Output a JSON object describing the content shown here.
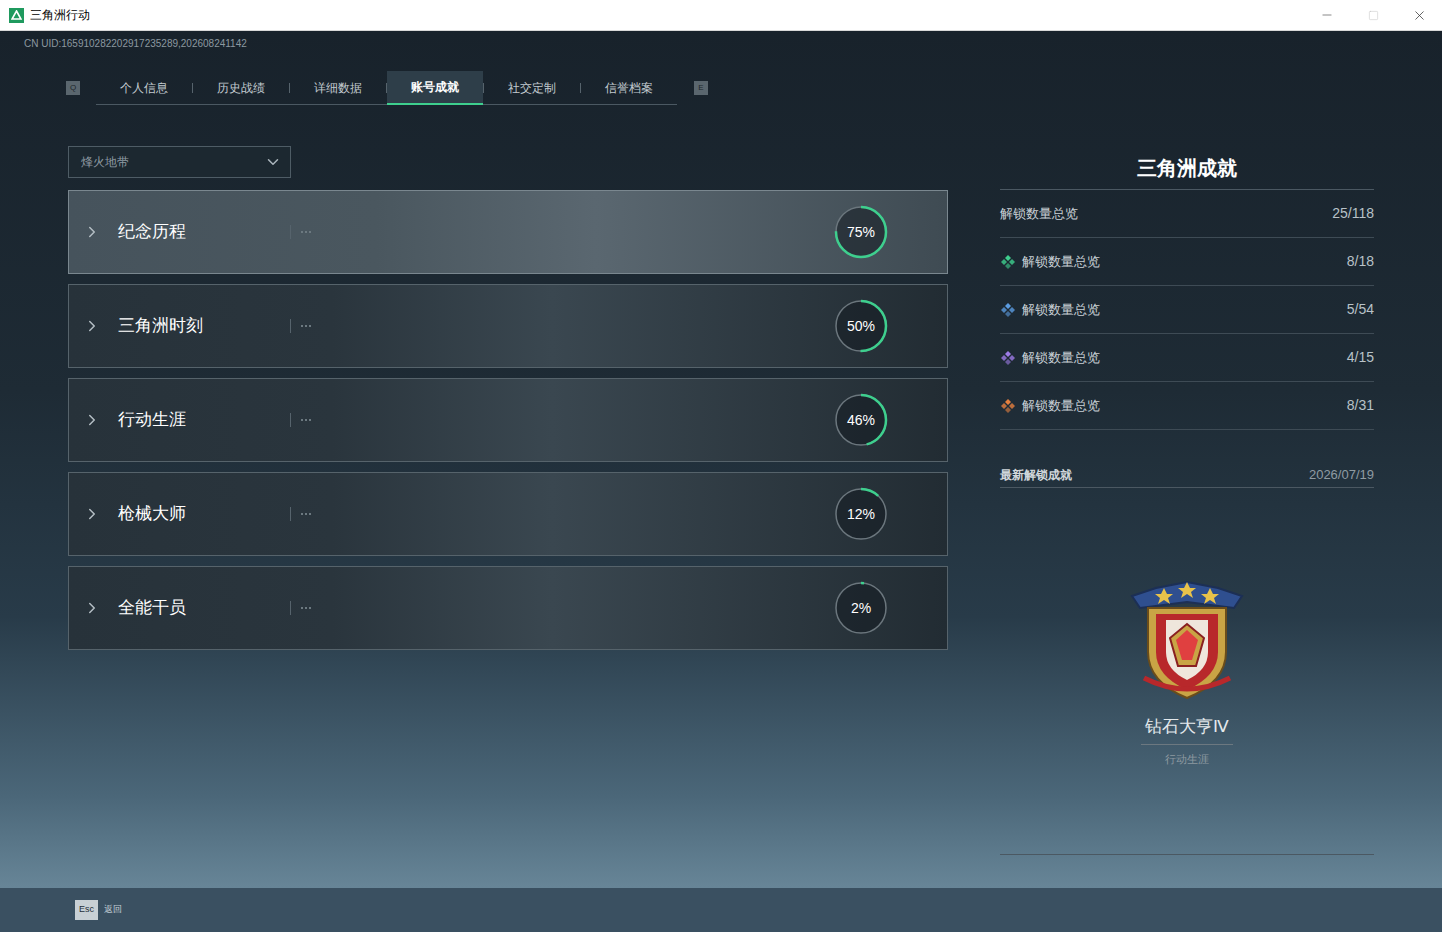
{
  "window": {
    "title": "三角洲行动"
  },
  "uid": "CN UID:165910282202917235289,202608241142",
  "tab_keys": {
    "prev": "Q",
    "next": "E"
  },
  "tabs": [
    {
      "label": "个人信息",
      "selected": false
    },
    {
      "label": "历史战绩",
      "selected": false
    },
    {
      "label": "详细数据",
      "selected": false
    },
    {
      "label": "账号成就",
      "selected": true
    },
    {
      "label": "社交定制",
      "selected": false
    },
    {
      "label": "信誉档案",
      "selected": false
    }
  ],
  "mode_select": {
    "value": "烽火地带",
    "expanded": false
  },
  "categories": [
    {
      "name": "纪念历程",
      "percent": "75%",
      "level": 0.75,
      "selected": true
    },
    {
      "name": "三角洲时刻",
      "percent": "50%",
      "level": 0.5,
      "selected": false
    },
    {
      "name": "行动生涯",
      "percent": "46%",
      "level": 0.46,
      "selected": false
    },
    {
      "name": "枪械大师",
      "percent": "12%",
      "level": 0.12,
      "selected": false
    },
    {
      "name": "全能干员",
      "percent": "2%",
      "level": 0.02,
      "selected": false
    }
  ],
  "summary": {
    "title": "三角洲成就",
    "rows": [
      {
        "label": "解锁数量总览",
        "count": "25/118",
        "kind": "total"
      },
      {
        "label": "解锁数量总览",
        "count": "8/18",
        "kind": "tier",
        "color": "#3ecf8e"
      },
      {
        "label": "解锁数量总览",
        "count": "5/54",
        "kind": "tier",
        "color": "#5b9be0"
      },
      {
        "label": "解锁数量总览",
        "count": "4/15",
        "kind": "tier",
        "color": "#9d7be6"
      },
      {
        "label": "解锁数量总览",
        "count": "8/31",
        "kind": "tier",
        "color": "#e5803f"
      }
    ]
  },
  "latest": {
    "label": "最新解锁成就",
    "date": "2026/07/19",
    "name": "钻石大亨Ⅳ",
    "category": "行动生涯"
  },
  "footer": {
    "key": "Esc",
    "label": "返回"
  }
}
